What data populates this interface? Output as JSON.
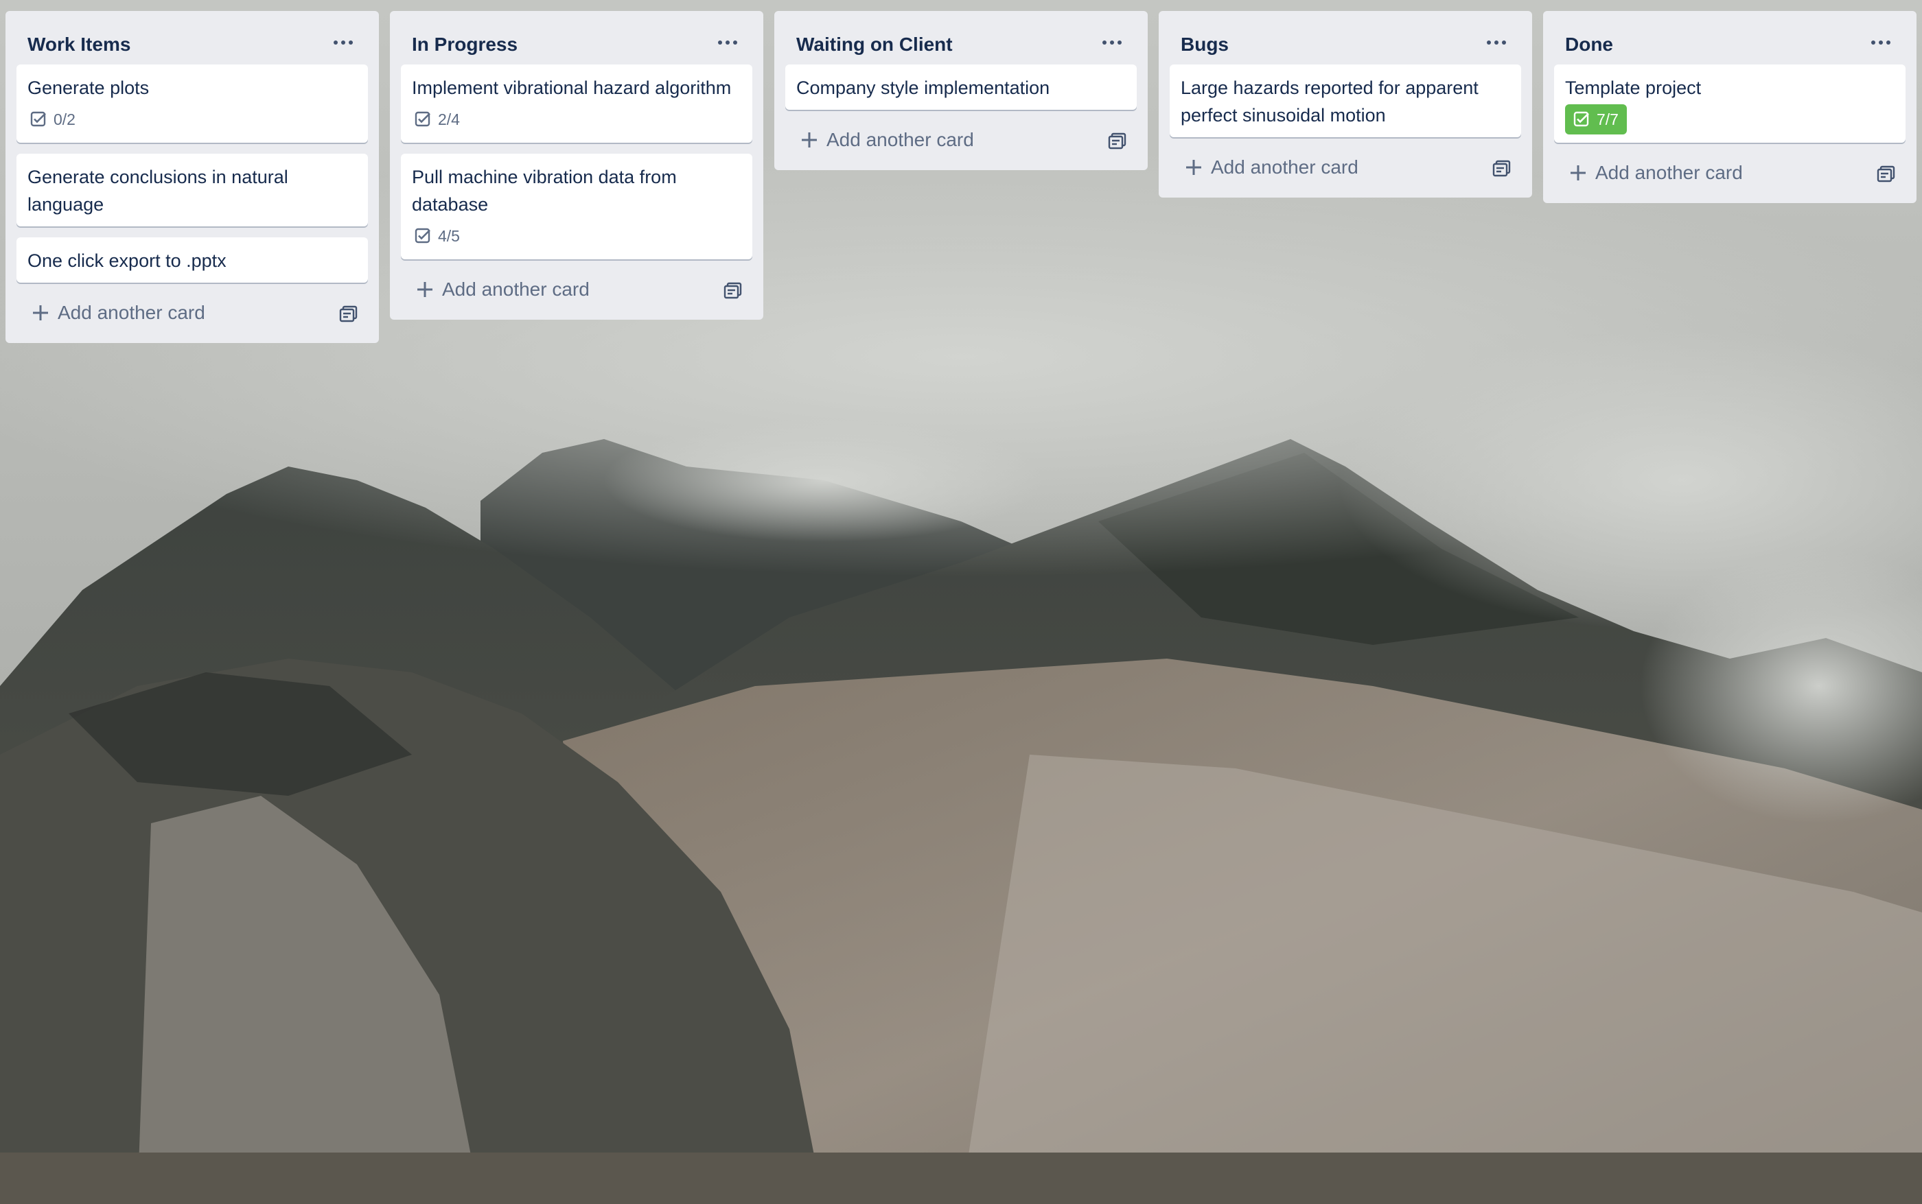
{
  "board": {
    "lists": [
      {
        "title": "Work Items",
        "cards": [
          {
            "title": "Generate plots",
            "checklist": "0/2",
            "complete": false
          },
          {
            "title": "Generate conclusions in natural language",
            "checklist": "",
            "complete": false
          },
          {
            "title": "One click export to .pptx",
            "checklist": "",
            "complete": false
          }
        ],
        "add_label": "Add another card"
      },
      {
        "title": "In Progress",
        "cards": [
          {
            "title": "Implement vibrational hazard algorithm",
            "checklist": "2/4",
            "complete": false
          },
          {
            "title": "Pull machine vibration data from database",
            "checklist": "4/5",
            "complete": false
          }
        ],
        "add_label": "Add another card"
      },
      {
        "title": "Waiting on Client",
        "cards": [
          {
            "title": "Company style implementation",
            "checklist": "",
            "complete": false
          }
        ],
        "add_label": "Add another card"
      },
      {
        "title": "Bugs",
        "cards": [
          {
            "title": "Large hazards reported for apparent perfect sinusoidal motion",
            "checklist": "",
            "complete": false
          }
        ],
        "add_label": "Add another card"
      },
      {
        "title": "Done",
        "cards": [
          {
            "title": "Template project",
            "checklist": "7/7",
            "complete": true
          }
        ],
        "add_label": "Add another card"
      }
    ]
  },
  "colors": {
    "list_bg": "#ebecf0",
    "card_bg": "#ffffff",
    "text": "#172b4d",
    "muted": "#5e6c84",
    "checklist_complete": "#61bd4f"
  },
  "icons": {
    "list_menu": "ellipsis-icon",
    "checklist": "checkbox-icon",
    "add": "plus-icon",
    "template": "card-template-icon"
  },
  "background": "mountain landscape photo"
}
